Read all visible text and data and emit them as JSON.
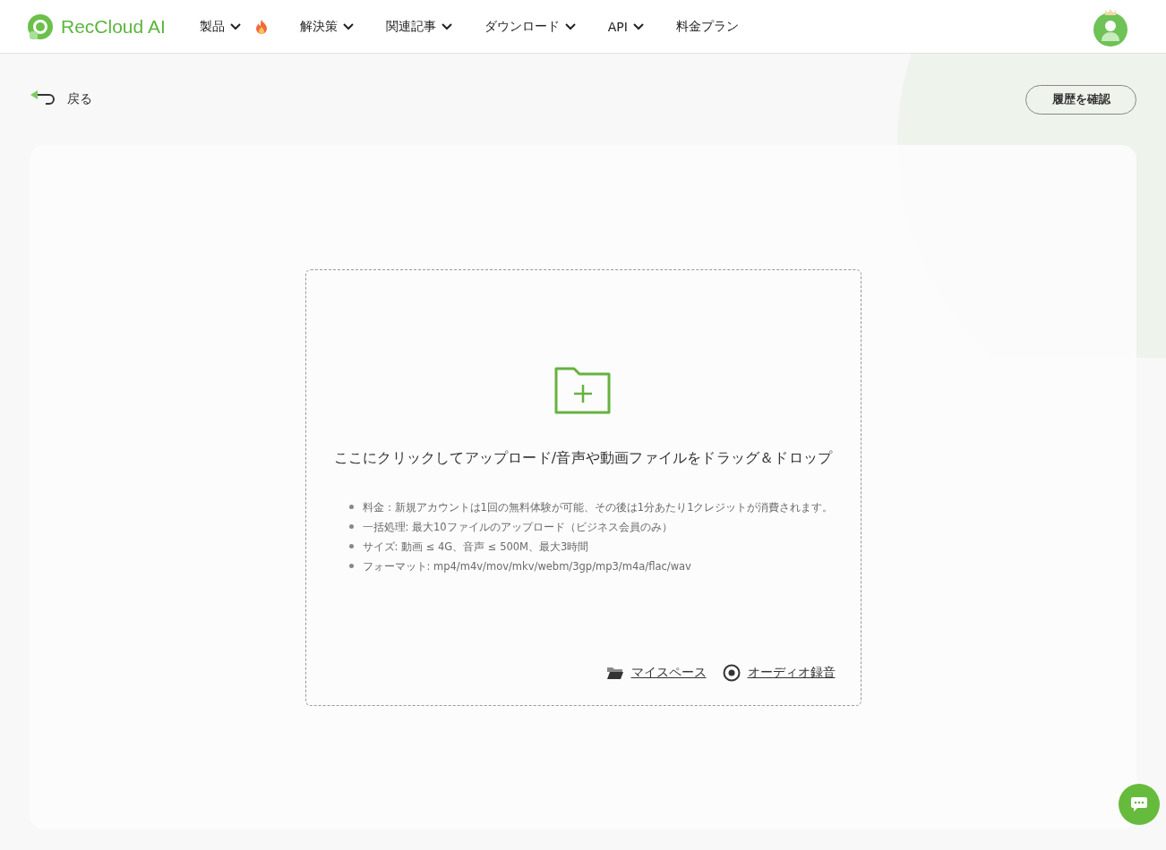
{
  "header": {
    "brand": "RecCloud AI",
    "nav": [
      {
        "label": "製品",
        "dropdown": true,
        "hot": true
      },
      {
        "label": "解決策",
        "dropdown": true,
        "hot": false
      },
      {
        "label": "関連記事",
        "dropdown": true,
        "hot": false
      },
      {
        "label": "ダウンロード",
        "dropdown": true,
        "hot": false
      },
      {
        "label": "API",
        "dropdown": true,
        "hot": false
      },
      {
        "label": "料金プラン",
        "dropdown": false,
        "hot": false
      }
    ]
  },
  "back": {
    "label": "戻る"
  },
  "history_button": "履歴を確認",
  "upload": {
    "prompt": "ここにクリックしてアップロード/音声や動画ファイルをドラッグ＆ドロップ",
    "notes": [
      "料金：新規アカウントは1回の無料体験が可能、その後は1分あたり1クレジットが消費されます。",
      "一括処理: 最大10ファイルのアップロード（ビジネス会員のみ）",
      "サイズ: 動画 ≤ 4G、音声 ≤ 500M、最大3時間",
      "フォーマット: mp4/m4v/mov/mkv/webm/3gp/mp3/m4a/flac/wav"
    ],
    "links": [
      {
        "kind": "folder",
        "label": "マイスペース"
      },
      {
        "kind": "record",
        "label": "オーディオ録音"
      }
    ]
  }
}
